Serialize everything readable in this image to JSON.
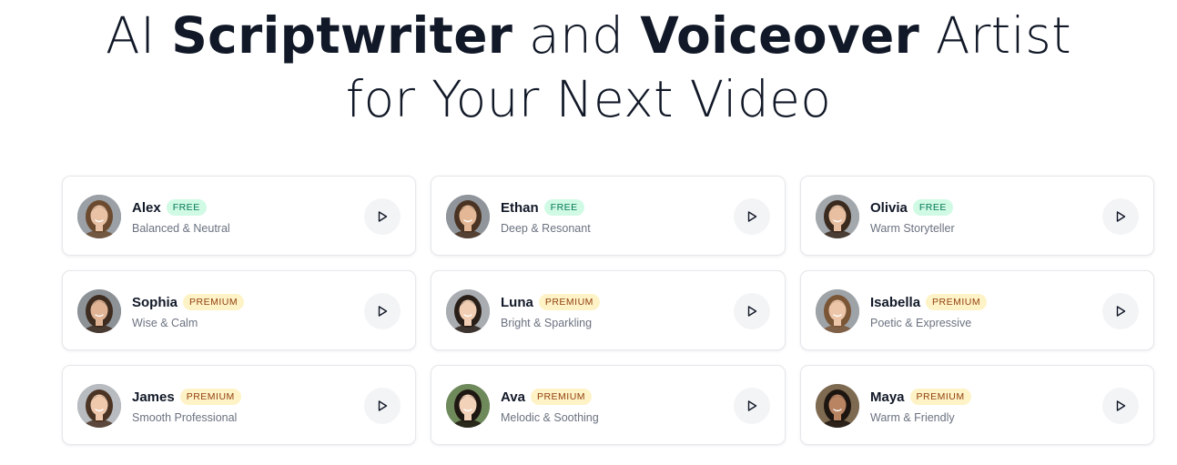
{
  "hero": {
    "line1_pre": "AI ",
    "line1_bold1": "Scriptwriter",
    "line1_mid": " and ",
    "line1_bold2": "Voiceover",
    "line1_post": " Artist",
    "line2": "for Your Next Video"
  },
  "voices": [
    {
      "name": "Alex",
      "badge": "FREE",
      "tier": "free",
      "description": "Balanced & Neutral",
      "avatar_hair": "#6b4a2f",
      "avatar_skin": "#e9c2a6",
      "avatar_bg": "#9aa0a6"
    },
    {
      "name": "Ethan",
      "badge": "FREE",
      "tier": "free",
      "description": "Deep & Resonant",
      "avatar_hair": "#4a3322",
      "avatar_skin": "#e4b896",
      "avatar_bg": "#8f959b"
    },
    {
      "name": "Olivia",
      "badge": "FREE",
      "tier": "free",
      "description": "Warm Storyteller",
      "avatar_hair": "#3b2a1e",
      "avatar_skin": "#e8bfa0",
      "avatar_bg": "#a3a8ad"
    },
    {
      "name": "Sophia",
      "badge": "PREMIUM",
      "tier": "premium",
      "description": "Wise & Calm",
      "avatar_hair": "#3e2c20",
      "avatar_skin": "#dfb394",
      "avatar_bg": "#8d9297"
    },
    {
      "name": "Luna",
      "badge": "PREMIUM",
      "tier": "premium",
      "description": "Bright & Sparkling",
      "avatar_hair": "#2a1f18",
      "avatar_skin": "#f0cdb3",
      "avatar_bg": "#a9adb2"
    },
    {
      "name": "Isabella",
      "badge": "PREMIUM",
      "tier": "premium",
      "description": "Poetic & Expressive",
      "avatar_hair": "#7a5536",
      "avatar_skin": "#ecc5a8",
      "avatar_bg": "#9ea3a8"
    },
    {
      "name": "James",
      "badge": "PREMIUM",
      "tier": "premium",
      "description": "Smooth Professional",
      "avatar_hair": "#4b3424",
      "avatar_skin": "#f0c9ad",
      "avatar_bg": "#b8bcc0"
    },
    {
      "name": "Ava",
      "badge": "PREMIUM",
      "tier": "premium",
      "description": "Melodic & Soothing",
      "avatar_hair": "#1f1712",
      "avatar_skin": "#f2d2b8",
      "avatar_bg": "#6f8a5a"
    },
    {
      "name": "Maya",
      "badge": "PREMIUM",
      "tier": "premium",
      "description": "Warm & Friendly",
      "avatar_hair": "#1d1510",
      "avatar_skin": "#b98462",
      "avatar_bg": "#7e6a50"
    }
  ],
  "icons": {
    "play": "play-icon",
    "avatar": "avatar-portrait"
  },
  "colors": {
    "free_badge_bg": "#d1fae5",
    "free_badge_text": "#047857",
    "premium_badge_bg": "#fef3c7",
    "premium_badge_text": "#92400e",
    "play_button_bg": "#f3f4f6"
  }
}
